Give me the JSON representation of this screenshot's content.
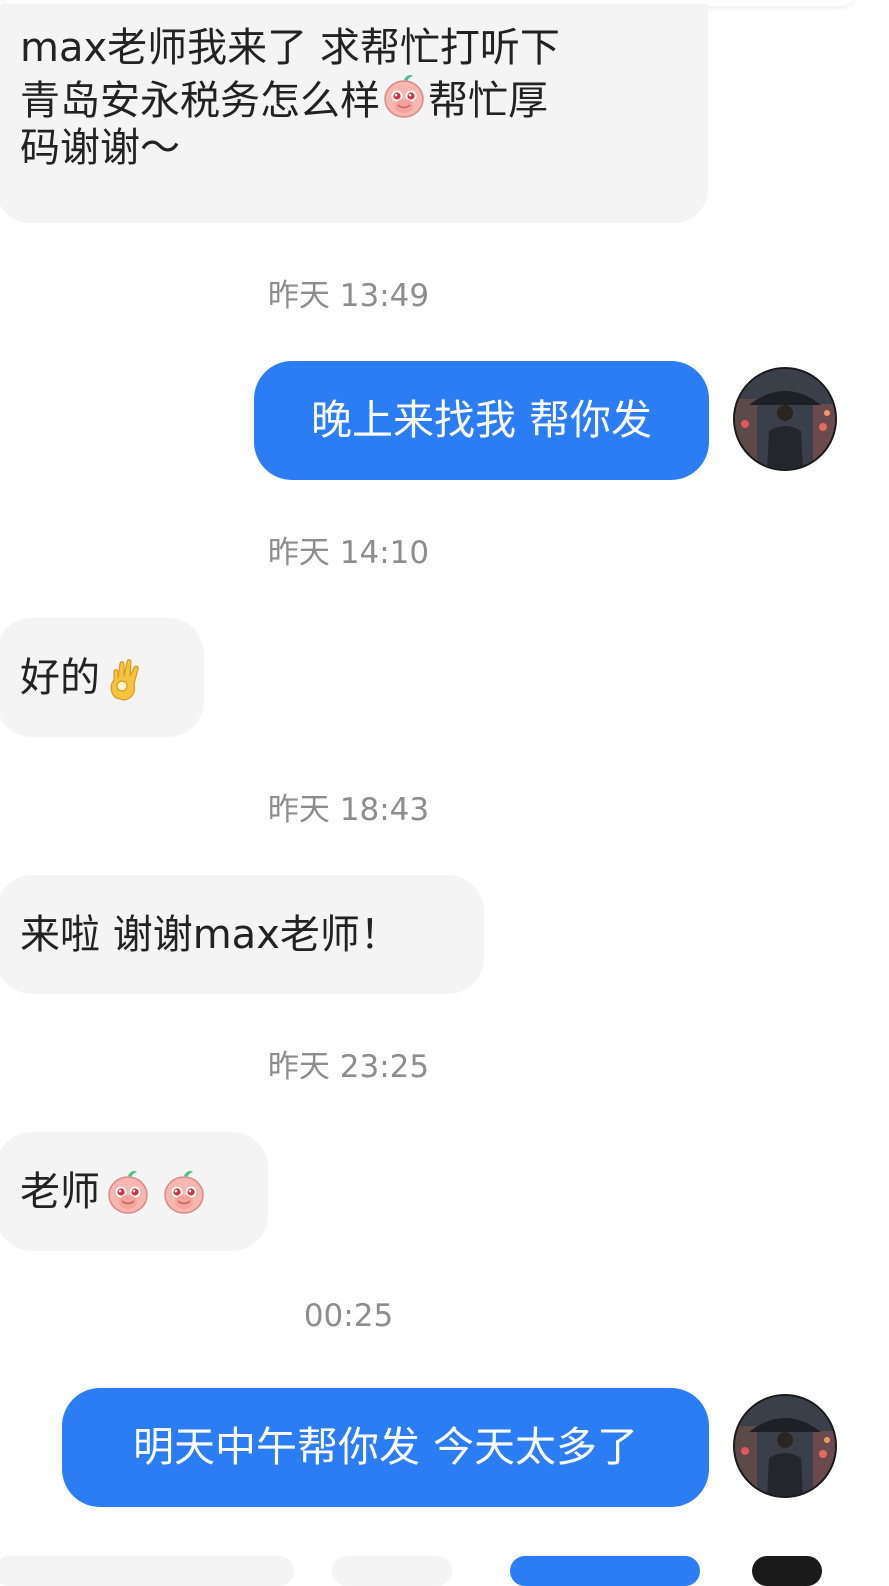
{
  "messages": [
    {
      "side": "in",
      "text_parts": [
        "max老师我来了 求帮忙打听下",
        "青岛安永税务怎么样",
        "帮忙厚",
        "码谢谢～"
      ]
    },
    {
      "time": "昨天 13:49"
    },
    {
      "side": "out",
      "text": "晚上来找我 帮你发"
    },
    {
      "time": "昨天 14:10"
    },
    {
      "side": "in",
      "text": "好的"
    },
    {
      "time": "昨天 18:43"
    },
    {
      "side": "in",
      "text": "来啦 谢谢max老师！"
    },
    {
      "time": "昨天 23:25"
    },
    {
      "side": "in",
      "text": "老师"
    },
    {
      "time": "00:25"
    },
    {
      "side": "out",
      "text": "明天中午帮你发 今天太多了"
    }
  ],
  "colors": {
    "outgoing_bubble": "#2c7df4",
    "incoming_bubble": "#f4f4f5",
    "timestamp": "#8d8d91"
  },
  "icons": {
    "peach_emoji": "peach-crying-emoji",
    "ok_emoji": "ok-hand-emoji",
    "avatar": "man-with-umbrella-avatar"
  }
}
